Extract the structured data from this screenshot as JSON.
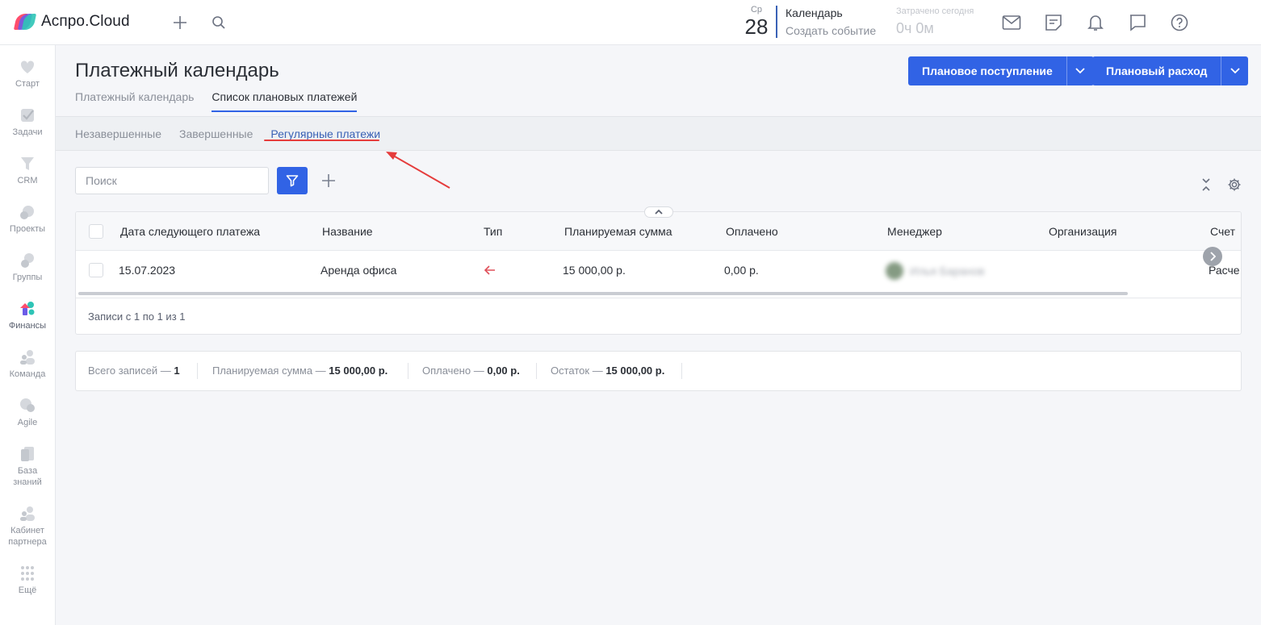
{
  "topbar": {
    "logo_text": "Аспро.Cloud",
    "date_dow": "Ср",
    "date_day": "28",
    "calendar_title": "Календарь",
    "create_event": "Создать событие",
    "spent_label": "Затрачено сегодня",
    "spent_value": "0ч 0м"
  },
  "sidebar": {
    "items": [
      {
        "label": "Старт"
      },
      {
        "label": "Задачи"
      },
      {
        "label": "CRM"
      },
      {
        "label": "Проекты"
      },
      {
        "label": "Группы"
      },
      {
        "label": "Финансы"
      },
      {
        "label": "Команда"
      },
      {
        "label": "Agile"
      },
      {
        "label": "База\nзнаний"
      },
      {
        "label": "Кабинет\nпартнера"
      },
      {
        "label": "Ещё"
      }
    ]
  },
  "header": {
    "title": "Платежный календарь",
    "tabs": [
      "Платежный календарь",
      "Список плановых платежей"
    ],
    "btn_income": "Плановое поступление",
    "btn_expense": "Плановый расход"
  },
  "subtabs": [
    "Незавершенные",
    "Завершенные",
    "Регулярные платежи"
  ],
  "toolbar": {
    "search_placeholder": "Поиск"
  },
  "table": {
    "columns": [
      "Дата следующего платежа",
      "Название",
      "Тип",
      "Планируемая сумма",
      "Оплачено",
      "Менеджер",
      "Организация",
      "Счет"
    ],
    "rows": [
      {
        "date": "15.07.2023",
        "name": "Аренда офиса",
        "type": "расход",
        "planned": "15 000,00 р.",
        "paid": "0,00 р.",
        "manager": "Илья Баранов",
        "org": "",
        "account": "Расче"
      }
    ],
    "records_text": "Записи с 1 по 1 из 1"
  },
  "summary": {
    "total_label": "Всего записей —",
    "total_value": "1",
    "planned_label": "Планируемая сумма —",
    "planned_value": "15 000,00 р.",
    "paid_label": "Оплачено —",
    "paid_value": "0,00 р.",
    "rest_label": "Остаток —",
    "rest_value": "15 000,00 р."
  },
  "colors": {
    "accent": "#3163e5",
    "annotation": "#e53c3c",
    "expense_arrow": "#e0505a"
  }
}
